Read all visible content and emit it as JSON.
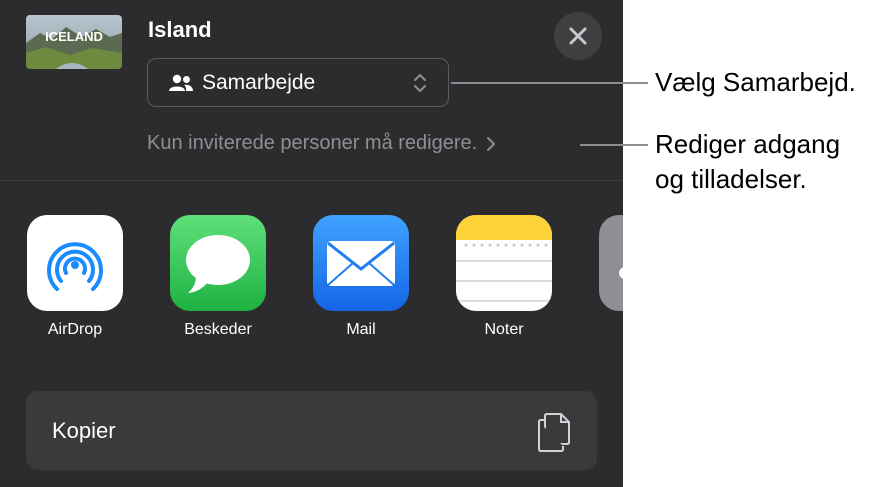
{
  "share_sheet": {
    "document_title": "Island",
    "thumbnail_text": "ICELAND",
    "collaboration_option": "Samarbejde",
    "access_summary": "Kun inviterede personer må redigere.",
    "apps": [
      {
        "name": "AirDrop",
        "icon": "airdrop-icon"
      },
      {
        "name": "Beskeder",
        "icon": "messages-icon"
      },
      {
        "name": "Mail",
        "icon": "mail-icon"
      },
      {
        "name": "Noter",
        "icon": "notes-icon"
      }
    ],
    "copy_label": "Kopier"
  },
  "callouts": {
    "collaborate": "Vælg Samarbejd.",
    "access_line1": "Rediger adgang",
    "access_line2": "og tilladelser."
  },
  "colors": {
    "sheet_background": "#2c2c2e",
    "row_background": "#3a3a3c",
    "airdrop_blue": "#1a8cff",
    "messages_green": "#34c759",
    "mail_blue": "#1f7cf5",
    "notes_yellow": "#fdd33a"
  }
}
